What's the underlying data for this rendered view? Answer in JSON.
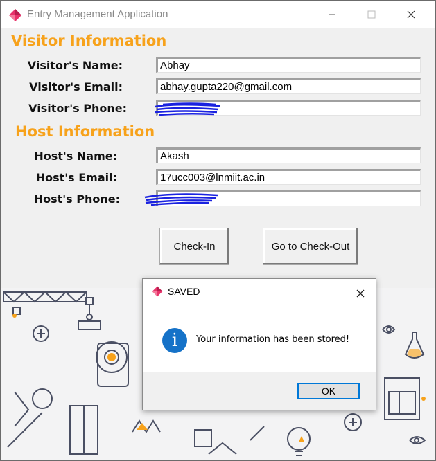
{
  "window": {
    "title": "Entry Management Application"
  },
  "visitor": {
    "heading": "Visitor Information",
    "name_label": "Visitor's Name:",
    "name_value": "Abhay",
    "email_label": "Visitor's Email:",
    "email_value": "abhay.gupta220@gmail.com",
    "phone_label": "Visitor's Phone:",
    "phone_value": ""
  },
  "host": {
    "heading": "Host Information",
    "name_label": "Host's Name:",
    "name_value": "Akash",
    "email_label": "Host's Email:",
    "email_value": "17ucc003@lnmiit.ac.in",
    "phone_label": "Host's Phone:",
    "phone_value": ""
  },
  "buttons": {
    "checkin": "Check-In",
    "checkout": "Go to Check-Out"
  },
  "dialog": {
    "title": "SAVED",
    "message": "Your information has been stored!",
    "ok": "OK",
    "icon": "info-icon"
  },
  "colors": {
    "section_heading": "#f7a21b",
    "redaction": "#1a22e0",
    "info_icon": "#1572c8",
    "ok_border": "#0078d7"
  }
}
